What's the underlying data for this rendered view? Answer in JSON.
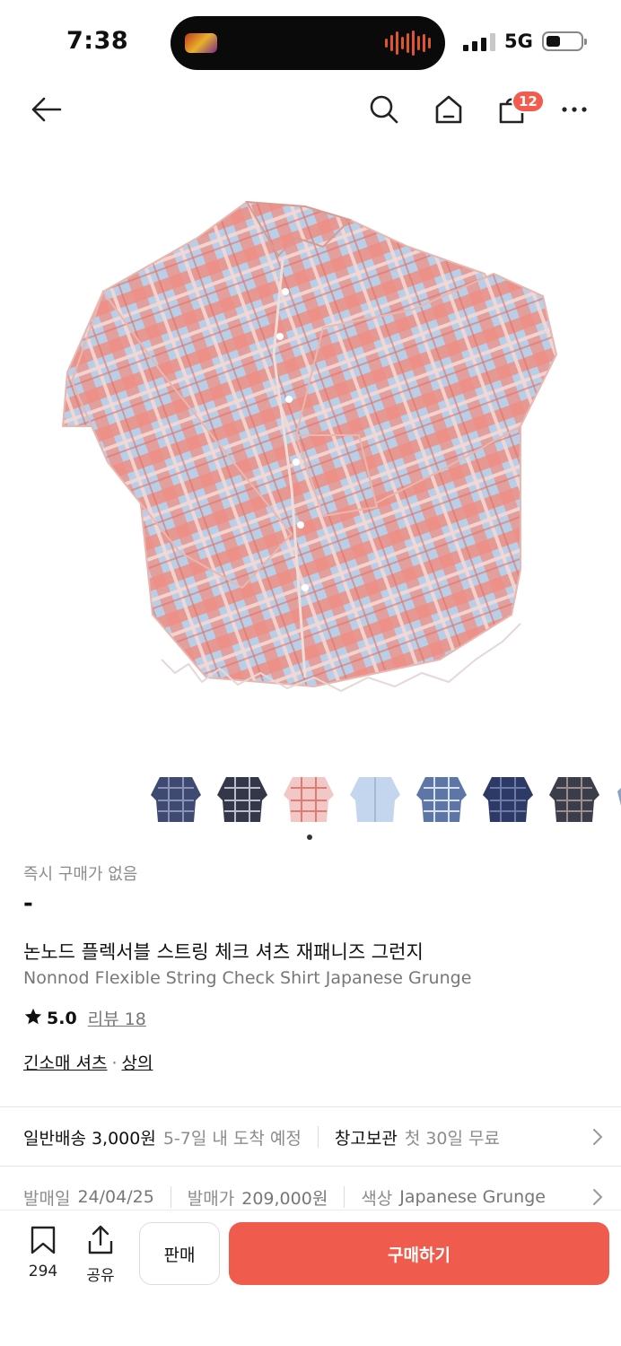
{
  "status_bar": {
    "time": "7:38",
    "network": "5G"
  },
  "nav": {
    "cart_count": "12"
  },
  "thumbnails": [
    {
      "name": "navy-check-shirt"
    },
    {
      "name": "dark-check-shirt"
    },
    {
      "name": "pink-check-shirt"
    },
    {
      "name": "light-blue-shirt"
    },
    {
      "name": "blue-check-shirt"
    },
    {
      "name": "navy-plaid-shirt"
    },
    {
      "name": "charcoal-check-shirt"
    }
  ],
  "product": {
    "instant_purchase_status": "즉시 구매가 없음",
    "price": "-",
    "title_ko": "논노드 플렉서블 스트링 체크 셔츠 재패니즈 그런지",
    "title_en": "Nonnod Flexible String Check Shirt Japanese Grunge",
    "rating": "5.0",
    "review_label": "리뷰 18",
    "category_primary": "긴소매 셔츠",
    "category_separator": "·",
    "category_secondary": "상의"
  },
  "shipping": {
    "method": "일반배송 3,000원",
    "eta": "5-7일 내 도착 예정",
    "storage_label": "창고보관",
    "storage_detail": "첫 30일 무료"
  },
  "meta": {
    "release_date_label": "발매일",
    "release_date": "24/04/25",
    "release_price_label": "발매가",
    "release_price": "209,000원",
    "color_label": "색상",
    "color": "Japanese Grunge"
  },
  "bottom_bar": {
    "bookmark_count": "294",
    "share_label": "공유",
    "sell_label": "판매",
    "buy_label": "구매하기"
  },
  "colors": {
    "accent": "#ef5b4c",
    "badge": "#f25b4d",
    "muted_text": "#8c8c8c"
  }
}
